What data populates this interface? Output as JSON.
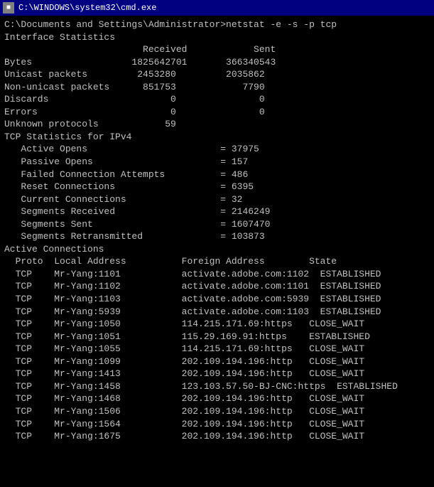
{
  "titleBar": {
    "icon": "■",
    "title": "C:\\WINDOWS\\system32\\cmd.exe"
  },
  "lines": [
    {
      "text": "C:\\Documents and Settings\\Administrator>netstat -e -s -p tcp",
      "style": ""
    },
    {
      "text": "Interface Statistics",
      "style": ""
    },
    {
      "text": "",
      "style": ""
    },
    {
      "text": "                         Received            Sent",
      "style": ""
    },
    {
      "text": "",
      "style": ""
    },
    {
      "text": "Bytes                  1825642701       366340543",
      "style": ""
    },
    {
      "text": "Unicast packets         2453280         2035862",
      "style": ""
    },
    {
      "text": "Non-unicast packets      851753            7790",
      "style": ""
    },
    {
      "text": "Discards                      0               0",
      "style": ""
    },
    {
      "text": "Errors                        0               0",
      "style": ""
    },
    {
      "text": "Unknown protocols            59",
      "style": ""
    },
    {
      "text": "",
      "style": ""
    },
    {
      "text": "TCP Statistics for IPv4",
      "style": ""
    },
    {
      "text": "",
      "style": ""
    },
    {
      "text": "   Active Opens                        = 37975",
      "style": ""
    },
    {
      "text": "   Passive Opens                       = 157",
      "style": ""
    },
    {
      "text": "   Failed Connection Attempts          = 486",
      "style": ""
    },
    {
      "text": "   Reset Connections                   = 6395",
      "style": ""
    },
    {
      "text": "   Current Connections                 = 32",
      "style": ""
    },
    {
      "text": "   Segments Received                   = 2146249",
      "style": ""
    },
    {
      "text": "   Segments Sent                       = 1607470",
      "style": ""
    },
    {
      "text": "   Segments Retransmitted              = 103873",
      "style": ""
    },
    {
      "text": "",
      "style": ""
    },
    {
      "text": "Active Connections",
      "style": ""
    },
    {
      "text": "",
      "style": ""
    },
    {
      "text": "  Proto  Local Address          Foreign Address        State",
      "style": ""
    },
    {
      "text": "  TCP    Mr-Yang:1101           activate.adobe.com:1102  ESTABLISHED",
      "style": ""
    },
    {
      "text": "  TCP    Mr-Yang:1102           activate.adobe.com:1101  ESTABLISHED",
      "style": ""
    },
    {
      "text": "  TCP    Mr-Yang:1103           activate.adobe.com:5939  ESTABLISHED",
      "style": ""
    },
    {
      "text": "  TCP    Mr-Yang:5939           activate.adobe.com:1103  ESTABLISHED",
      "style": ""
    },
    {
      "text": "  TCP    Mr-Yang:1050           114.215.171.69:https   CLOSE_WAIT",
      "style": ""
    },
    {
      "text": "  TCP    Mr-Yang:1051           115.29.169.91:https    ESTABLISHED",
      "style": ""
    },
    {
      "text": "  TCP    Mr-Yang:1055           114.215.171.69:https   CLOSE_WAIT",
      "style": ""
    },
    {
      "text": "  TCP    Mr-Yang:1099           202.109.194.196:http   CLOSE_WAIT",
      "style": ""
    },
    {
      "text": "  TCP    Mr-Yang:1413           202.109.194.196:http   CLOSE_WAIT",
      "style": ""
    },
    {
      "text": "  TCP    Mr-Yang:1458           123.103.57.50-BJ-CNC:https  ESTABLISHED",
      "style": ""
    },
    {
      "text": "  TCP    Mr-Yang:1468           202.109.194.196:http   CLOSE_WAIT",
      "style": ""
    },
    {
      "text": "  TCP    Mr-Yang:1506           202.109.194.196:http   CLOSE_WAIT",
      "style": ""
    },
    {
      "text": "  TCP    Mr-Yang:1564           202.109.194.196:http   CLOSE_WAIT",
      "style": ""
    },
    {
      "text": "  TCP    Mr-Yang:1675           202.109.194.196:http   CLOSE_WAIT",
      "style": ""
    }
  ]
}
